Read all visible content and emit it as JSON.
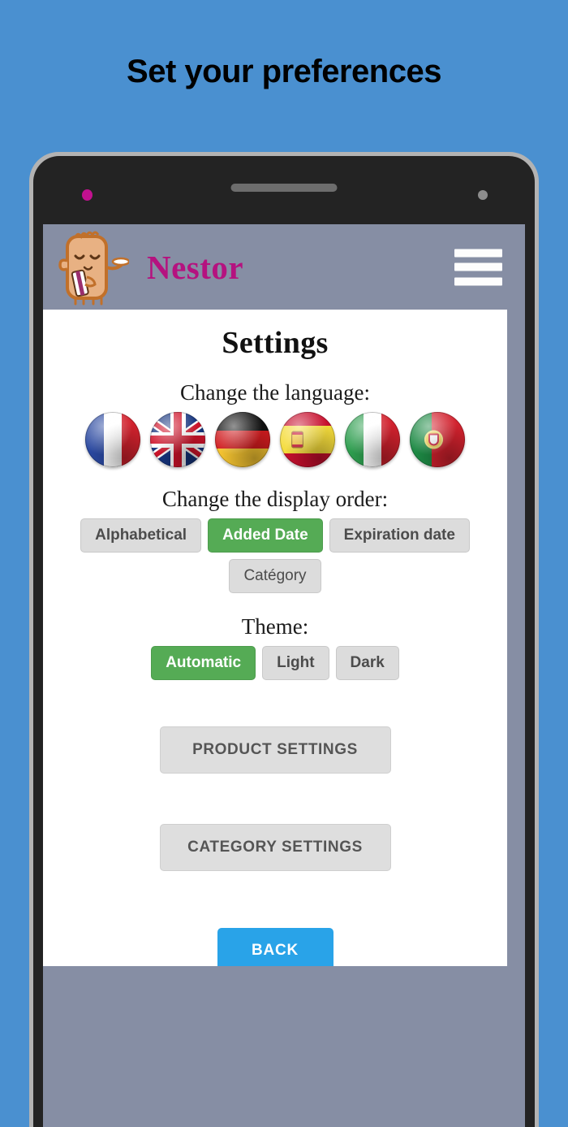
{
  "promo": {
    "headline": "Set your preferences"
  },
  "appbar": {
    "brand": "Nestor",
    "mascot_icon": "nestor-mascot-icon",
    "menu_icon": "hamburger-menu-icon"
  },
  "device": {
    "led_icon": "notification-led-icon",
    "speaker_icon": "earpiece-speaker-icon",
    "camera_icon": "front-camera-icon"
  },
  "page": {
    "title": "Settings"
  },
  "language": {
    "label": "Change the language:",
    "options": [
      {
        "name": "french-flag-icon",
        "country": "France"
      },
      {
        "name": "uk-flag-icon",
        "country": "United Kingdom"
      },
      {
        "name": "german-flag-icon",
        "country": "Germany"
      },
      {
        "name": "spanish-flag-icon",
        "country": "Spain"
      },
      {
        "name": "italian-flag-icon",
        "country": "Italy"
      },
      {
        "name": "portuguese-flag-icon",
        "country": "Portugal"
      }
    ]
  },
  "display_order": {
    "label": "Change the display order:",
    "options": [
      {
        "label": "Alphabetical",
        "selected": false
      },
      {
        "label": "Added Date",
        "selected": true
      },
      {
        "label": "Expiration date",
        "selected": false
      },
      {
        "label": "Catégory",
        "selected": false
      }
    ]
  },
  "theme": {
    "label": "Theme:",
    "options": [
      {
        "label": "Automatic",
        "selected": true
      },
      {
        "label": "Light",
        "selected": false
      },
      {
        "label": "Dark",
        "selected": false
      }
    ]
  },
  "actions": {
    "product_settings": "PRODUCT SETTINGS",
    "category_settings": "CATEGORY SETTINGS",
    "back": "BACK"
  },
  "colors": {
    "page_background": "#4a90d0",
    "app_bar": "#868ea4",
    "brand_text": "#b5127f",
    "selected_chip": "#55ab55",
    "back_button": "#29a3e8",
    "chip_default": "#dcdcdc"
  }
}
